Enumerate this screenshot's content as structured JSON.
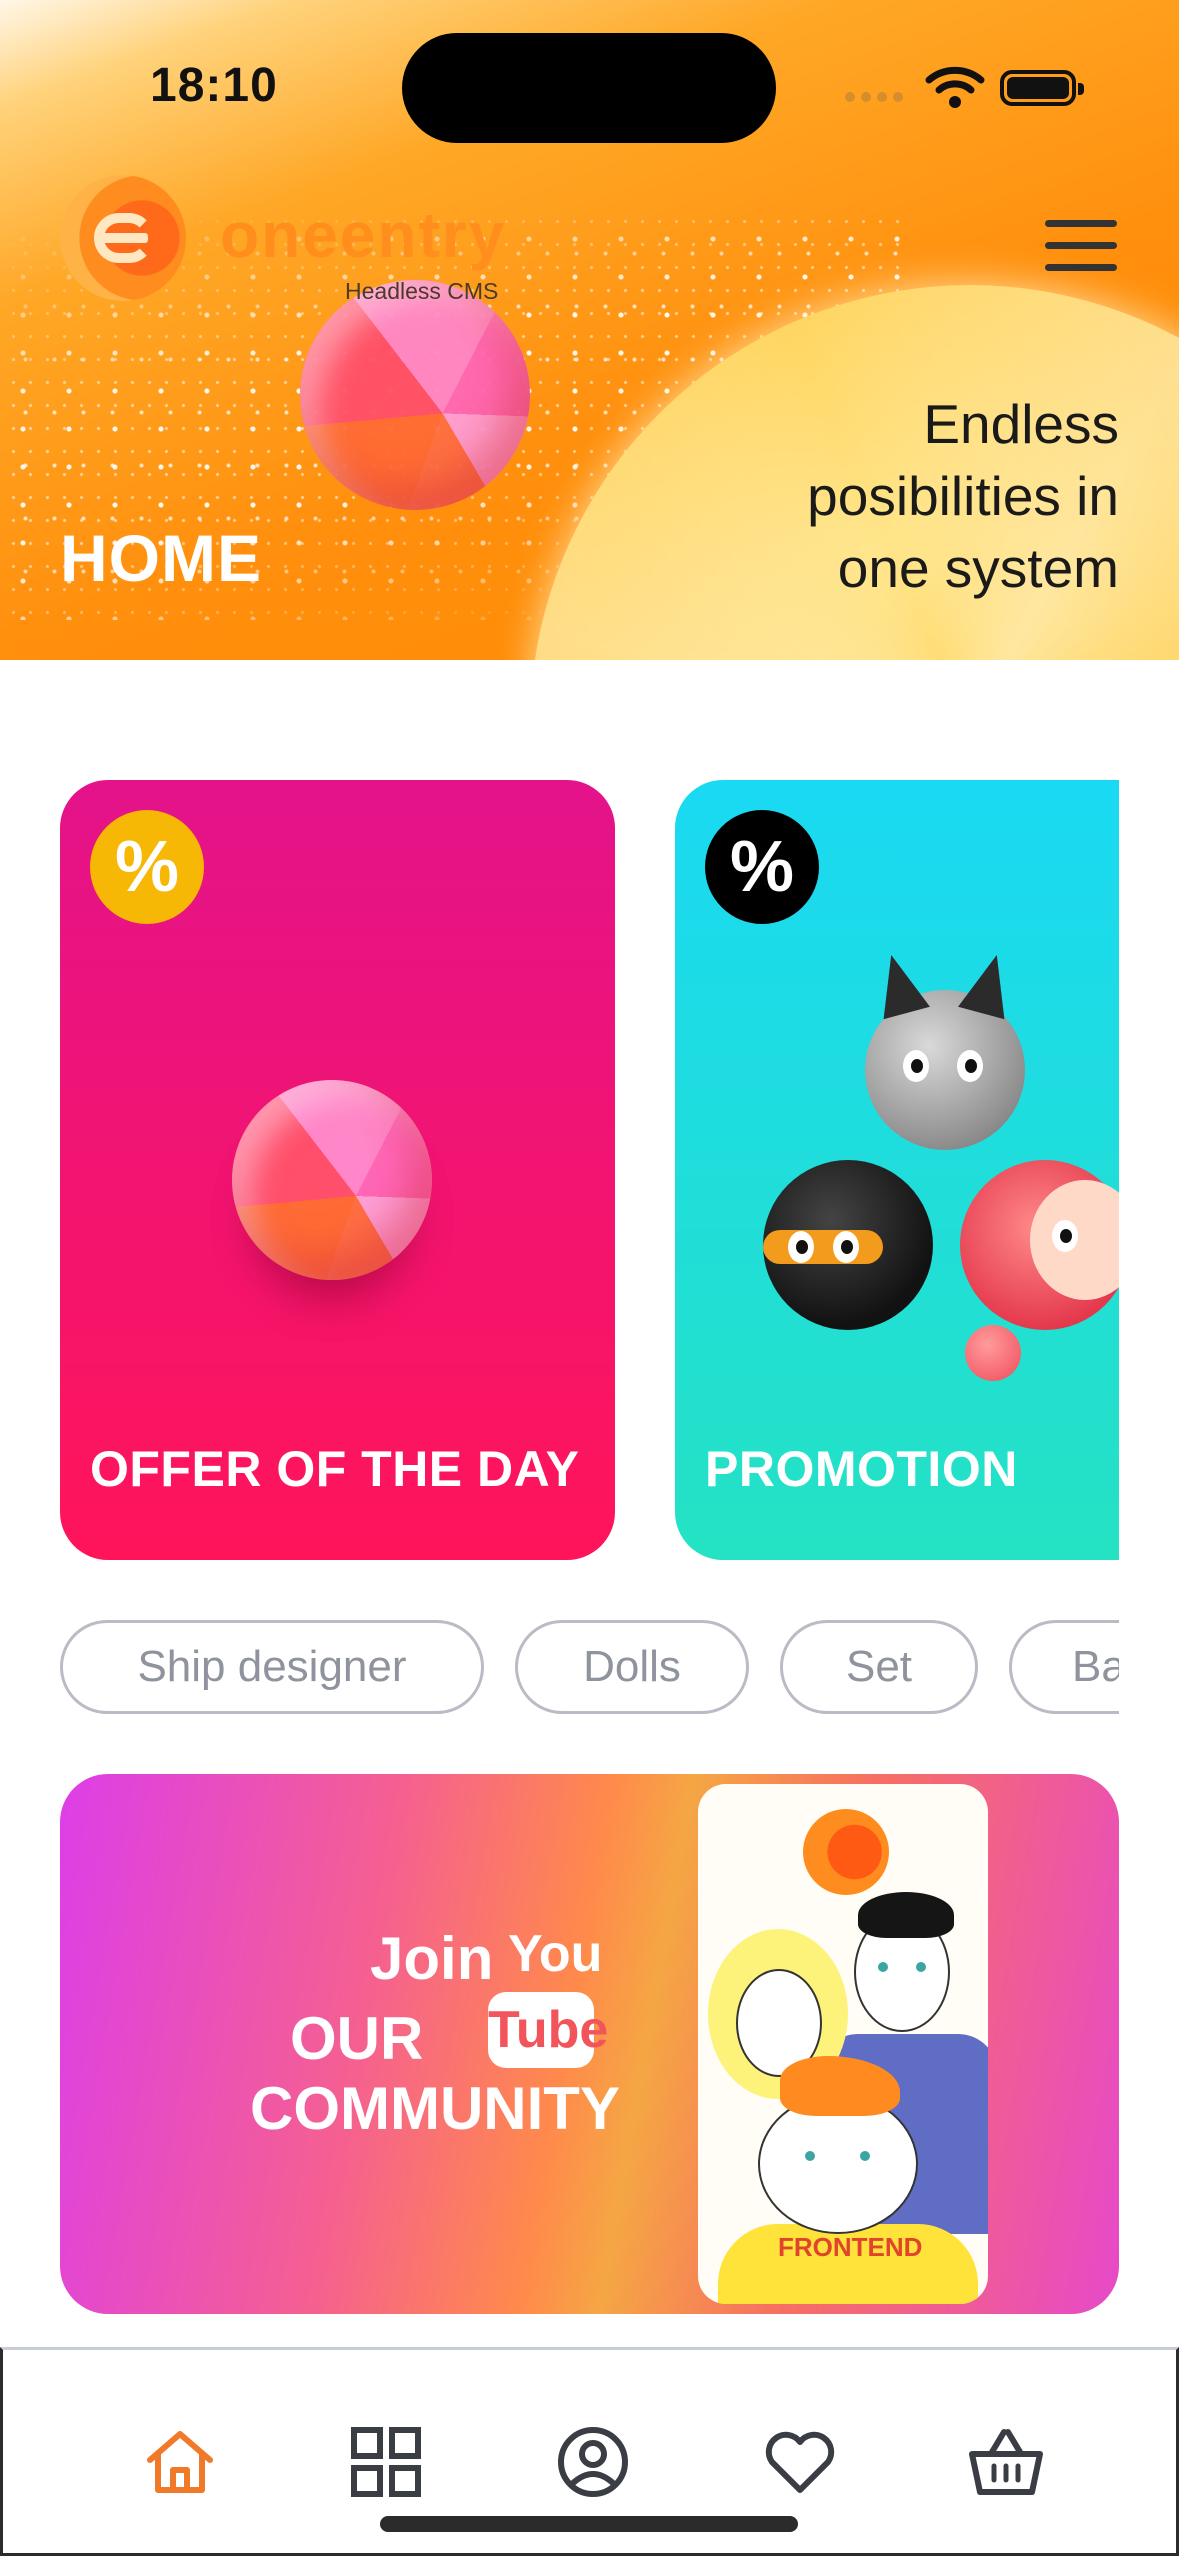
{
  "status_bar": {
    "time": "18:10"
  },
  "header": {
    "brand": "oneentry",
    "brand_sub": "Headless CMS",
    "title": "HOME",
    "tagline_lines": [
      "Endless",
      "posibilities in",
      "one system"
    ]
  },
  "cards": [
    {
      "label": "OFFER OF THE DAY",
      "badge": "%",
      "badge_color": "#f6b705"
    },
    {
      "label": "PROMOTION",
      "badge": "%",
      "badge_color": "#000000"
    }
  ],
  "chips": [
    "Ship designer",
    "Dolls",
    "Set",
    "Ba"
  ],
  "banner": {
    "join": "Join",
    "you": "You",
    "tube": "Tube",
    "our": "OUR",
    "community": "COMMUNITY",
    "art_text": "FRONTEND"
  },
  "tabbar": {
    "items": [
      "home-icon",
      "grid-icon",
      "profile-icon",
      "heart-icon",
      "basket-icon"
    ],
    "active_color": "#f07a2a",
    "inactive_color": "#3a3d44"
  },
  "colors": {
    "accent": "#ff8e1c",
    "offer_card": "#e4138a",
    "promo_card": "#1ad9f3"
  }
}
